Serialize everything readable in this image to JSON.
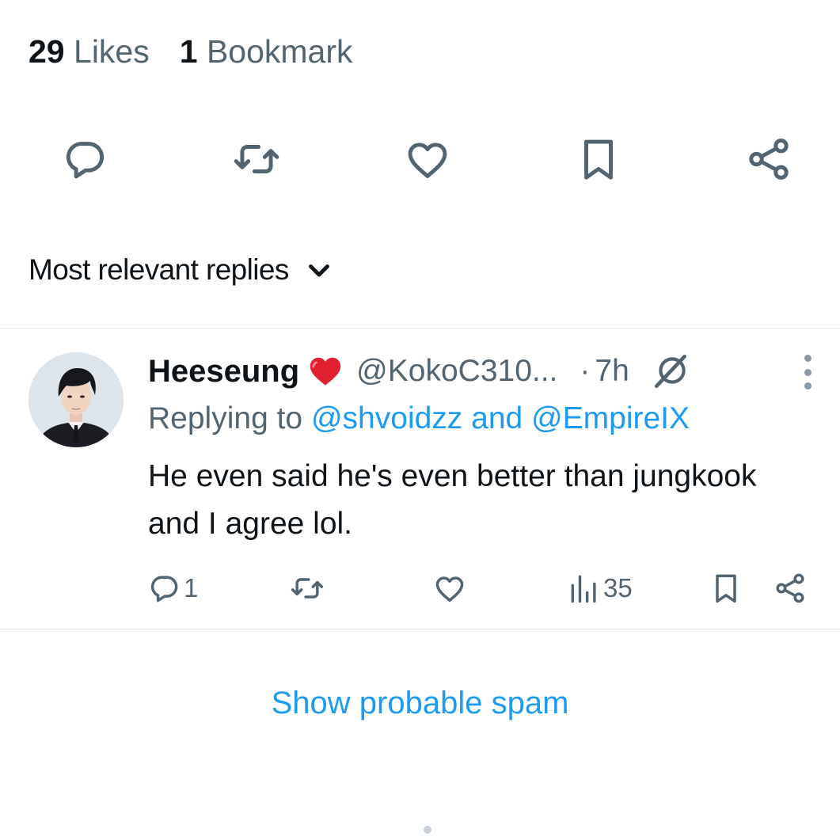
{
  "stats": {
    "likes_count": "29",
    "likes_label": "Likes",
    "bookmarks_count": "1",
    "bookmarks_label": "Bookmark"
  },
  "tweet_actions": [
    "reply-icon",
    "retweet-icon",
    "like-icon",
    "bookmark-icon",
    "share-icon"
  ],
  "sort": {
    "label": "Most relevant replies",
    "icon": "chevron-down-icon"
  },
  "reply": {
    "author_name": "Heeseung",
    "author_emoji": "red-heart",
    "handle": "@KokoC310...",
    "separator": "·",
    "time": "7h",
    "replying_prefix": "Replying to",
    "replying_to_1": "@shvoidzz",
    "replying_joiner": "and",
    "replying_to_2": "@EmpireIX",
    "text": "He even said he's even better than jungkook and I agree lol.",
    "reply_count": "1",
    "views_count": "35"
  },
  "spam_link": "Show probable spam",
  "colors": {
    "text_primary": "#0f1419",
    "text_secondary": "#536471",
    "link": "#1d9bf0",
    "divider": "#dfe3e7"
  }
}
